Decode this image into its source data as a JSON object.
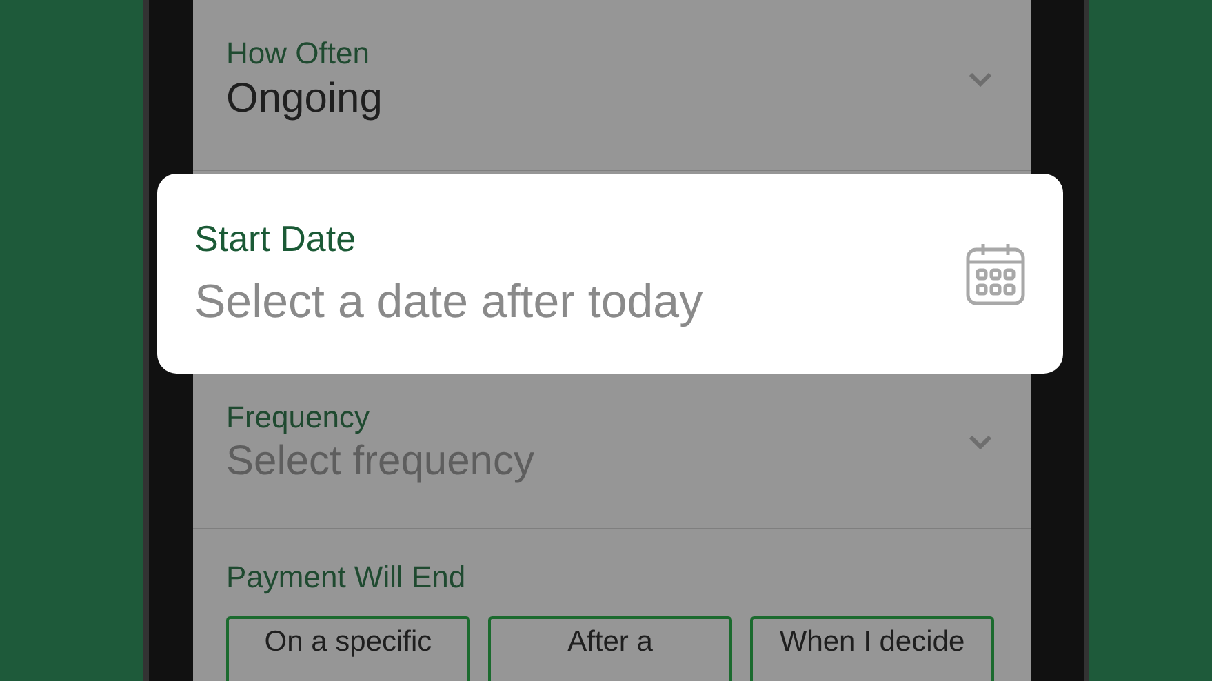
{
  "how_often": {
    "label": "How Often",
    "value": "Ongoing"
  },
  "start_date": {
    "label": "Start Date",
    "placeholder": "Select a date after today"
  },
  "frequency": {
    "label": "Frequency",
    "placeholder": "Select frequency"
  },
  "payment_end": {
    "label": "Payment Will End",
    "options": [
      {
        "label": "On a specific",
        "selected": false
      },
      {
        "label": "After a",
        "selected": false
      },
      {
        "label": "When I decide",
        "selected": false
      }
    ]
  }
}
